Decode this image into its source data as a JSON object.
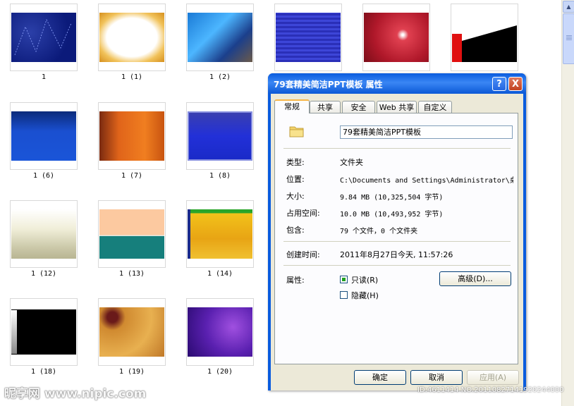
{
  "thumbnails": [
    {
      "caption": "1"
    },
    {
      "caption": "1 (1)"
    },
    {
      "caption": "1 (2)"
    },
    {
      "caption": ""
    },
    {
      "caption": ""
    },
    {
      "caption": ""
    },
    {
      "caption": "1 (6)"
    },
    {
      "caption": "1 (7)"
    },
    {
      "caption": "1 (8)"
    },
    {
      "caption": "1 (12)"
    },
    {
      "caption": "1 (13)"
    },
    {
      "caption": "1 (14)"
    },
    {
      "caption": "1 (18)"
    },
    {
      "caption": "1 (19)"
    },
    {
      "caption": "1 (20)"
    }
  ],
  "dialog": {
    "title": "79套精美简洁PPT模板 属性",
    "help_glyph": "?",
    "close_glyph": "X",
    "tabs": [
      "常规",
      "共享",
      "安全",
      "Web 共享",
      "自定义"
    ],
    "active_tab": "常规",
    "name_value": "79套精美简洁PPT模板",
    "fields": {
      "type_label": "类型:",
      "type_value": "文件夹",
      "location_label": "位置:",
      "location_value": "C:\\Documents and Settings\\Administrator\\桌",
      "size_label": "大小:",
      "size_value": "9.84 MB (10,325,504 字节)",
      "disk_label": "占用空间:",
      "disk_value": "10.0 MB (10,493,952 字节)",
      "contains_label": "包含:",
      "contains_value": "79 个文件，0 个文件夹",
      "created_label": "创建时间:",
      "created_value": "2011年8月27日今天, 11:57:26",
      "attributes_label": "属性:"
    },
    "readonly_label": "只读(R)",
    "readonly_checked": true,
    "hidden_label": "隐藏(H)",
    "hidden_checked": false,
    "advanced_label": "高级(D)...",
    "ok_label": "确定",
    "cancel_label": "取消",
    "apply_label": "应用(A)"
  },
  "watermark": {
    "site": "昵享网 www.nipic.com",
    "id_text": "ID:4611414 NO:20110827141920244000"
  },
  "colors": {
    "titlebar": "#0a5cde",
    "dialog_face": "#ece9d8",
    "tab_highlight": "#f7b546"
  }
}
